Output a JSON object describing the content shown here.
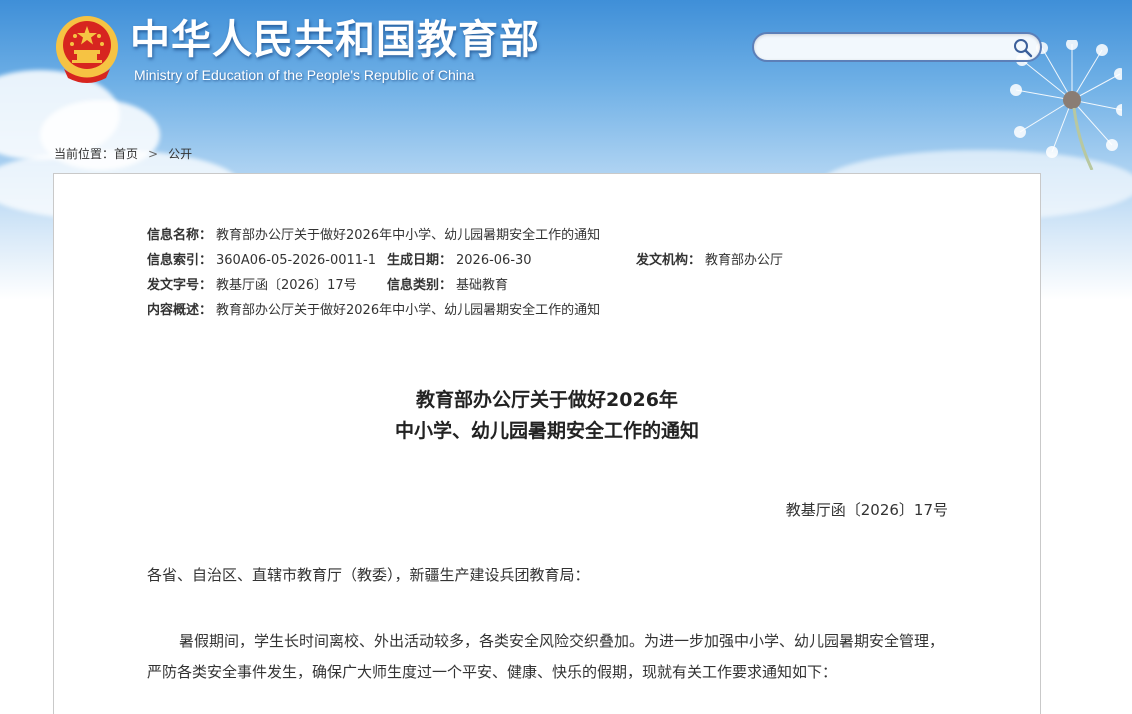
{
  "header": {
    "title": "中华人民共和国教育部",
    "subtitle": "Ministry of Education of the People's Republic of China",
    "search": {
      "placeholder": "",
      "value": ""
    }
  },
  "breadcrumb": {
    "prefix": "当前位置：",
    "items": [
      "首页",
      "公开"
    ]
  },
  "meta": {
    "name_label": "信息名称：",
    "name_value": "教育部办公厅关于做好2026年中小学、幼儿园暑期安全工作的通知",
    "index_label": "信息索引：",
    "index_value": "360A06-05-2026-0011-1",
    "date_label": "生成日期：",
    "date_value": "2026-06-30",
    "org_label": "发文机构：",
    "org_value": "教育部办公厅",
    "docno_label": "发文字号：",
    "docno_value": "教基厅函〔2026〕17号",
    "category_label": "信息类别：",
    "category_value": "基础教育",
    "summary_label": "内容概述：",
    "summary_value": "教育部办公厅关于做好2026年中小学、幼儿园暑期安全工作的通知"
  },
  "document": {
    "title_line1": "教育部办公厅关于做好2026年",
    "title_line2": "中小学、幼儿园暑期安全工作的通知",
    "number": "教基厅函〔2026〕17号",
    "addressee": "各省、自治区、直辖市教育厅（教委），新疆生产建设兵团教育局：",
    "paragraph1": "暑假期间，学生长时间离校、外出活动较多，各类安全风险交织叠加。为进一步加强中小学、幼儿园暑期安全管理，严防各类安全事件发生，确保广大师生度过一个平安、健康、快乐的假期，现就有关工作要求通知如下："
  },
  "colors": {
    "sky_top": "#3f8fd8",
    "emblem_red": "#d7251f",
    "emblem_gold": "#f6c343",
    "text": "#333333",
    "search_border": "#5c7fb8"
  },
  "icons": {
    "emblem": "national-emblem-icon",
    "search": "search-icon",
    "separator": "chevron-right-icon"
  }
}
